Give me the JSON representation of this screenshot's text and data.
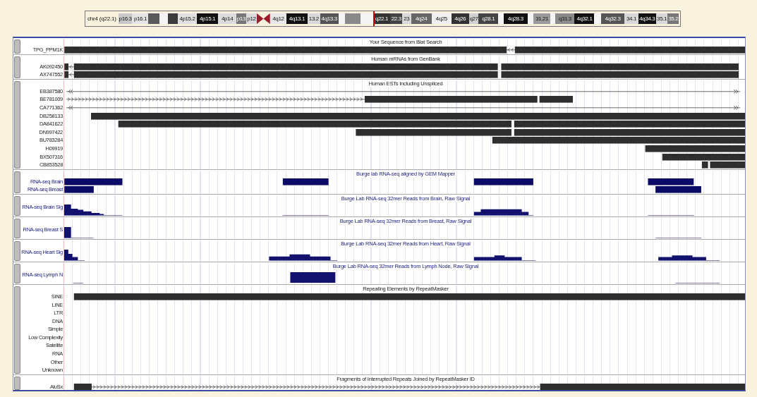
{
  "ideogram": {
    "label": "chr4 (q22.1)",
    "bands": [
      {
        "label": "p16.3",
        "color": "#c8c8c8",
        "kind": "band",
        "marked": false
      },
      {
        "label": "p16.1",
        "color": "#e4e4e4",
        "kind": "band",
        "marked": false
      },
      {
        "color": "#5a5a5a",
        "kind": "band",
        "marked": false
      },
      {
        "color": "#f4f4f4",
        "kind": "band",
        "marked": false
      },
      {
        "color": "#3c3c3c",
        "kind": "band",
        "marked": false
      },
      {
        "label": "4p15.2",
        "color": "#e0e0e0",
        "kind": "band",
        "marked": false
      },
      {
        "label": "4p15.1",
        "color": "#111111",
        "kind": "band",
        "marked": false
      },
      {
        "label": "4p14",
        "color": "#dcdcdc",
        "kind": "band",
        "marked": false
      },
      {
        "label": "p13",
        "color": "#777777",
        "kind": "band",
        "marked": false
      },
      {
        "label": "p12",
        "color": "#dcdcdc",
        "kind": "band",
        "marked": false
      },
      {
        "color": "#9b1c2c",
        "kind": "centromere",
        "marked": false
      },
      {
        "label": "4q12",
        "color": "#e8e8e8",
        "kind": "band",
        "marked": false
      },
      {
        "label": "4q13.1",
        "color": "#111111",
        "kind": "band",
        "marked": false
      },
      {
        "label": "13.2",
        "color": "#d8d8d8",
        "kind": "band",
        "marked": false
      },
      {
        "label": "4q13.3",
        "color": "#555555",
        "kind": "band",
        "marked": false
      },
      {
        "color": "#f4f4f4",
        "kind": "band",
        "marked": false
      },
      {
        "color": "#8a8a8a",
        "kind": "band",
        "marked": false
      },
      {
        "color": "#f4f4f4",
        "kind": "band",
        "marked": false
      },
      {
        "label": "q22.1",
        "color": "#333333",
        "kind": "band",
        "marked": true
      },
      {
        "label": "22.3",
        "color": "#444444",
        "kind": "band",
        "marked": false
      },
      {
        "label": "23",
        "color": "#d8d8d8",
        "kind": "band",
        "marked": false
      },
      {
        "label": "4q24",
        "color": "#666666",
        "kind": "band",
        "marked": false
      },
      {
        "label": "4q25",
        "color": "#f0f0f0",
        "kind": "band",
        "marked": false
      },
      {
        "label": "4q26",
        "color": "#333333",
        "kind": "band",
        "marked": false
      },
      {
        "label": "q27",
        "color": "#d0d0d0",
        "kind": "band",
        "marked": false
      },
      {
        "label": "q28.1",
        "color": "#444444",
        "kind": "band",
        "marked": false
      },
      {
        "color": "#f4f4f4",
        "kind": "band",
        "marked": false
      },
      {
        "label": "4q28.3",
        "color": "#111111",
        "kind": "band",
        "marked": false
      },
      {
        "color": "#f4f4f4",
        "kind": "band",
        "marked": false
      },
      {
        "label": "31.21",
        "color": "#9a9a9a",
        "kind": "band",
        "marked": false
      },
      {
        "color": "#f4f4f4",
        "kind": "band",
        "marked": false
      },
      {
        "label": "q31.3",
        "color": "#8a8a8a",
        "kind": "band",
        "marked": false
      },
      {
        "label": "4q32.1",
        "color": "#111111",
        "kind": "band",
        "marked": false
      },
      {
        "color": "#f4f4f4",
        "kind": "band",
        "marked": false
      },
      {
        "label": "4q32.3",
        "color": "#555555",
        "kind": "band",
        "marked": false
      },
      {
        "label": "34.1",
        "color": "#d8d8d8",
        "kind": "band",
        "marked": false
      },
      {
        "label": "4q34.3",
        "color": "#111111",
        "kind": "band",
        "marked": false
      },
      {
        "label": "35.1",
        "color": "#d8d8d8",
        "kind": "band",
        "marked": false
      },
      {
        "label": "35.2",
        "color": "#777777",
        "kind": "band",
        "marked": false
      }
    ]
  },
  "tracks": [
    {
      "title": "Your Sequence from Blat Search",
      "kind": "annotation",
      "rows": [
        {
          "label": "TPG_PPM1K"
        }
      ]
    },
    {
      "title": "Human mRNAs from GenBank",
      "kind": "annotation",
      "rows": [
        {
          "label": "AK092450"
        },
        {
          "label": "AX747552"
        }
      ]
    },
    {
      "title": "Human ESTs Including Unspliced",
      "kind": "annotation",
      "rows": [
        {
          "label": "EB387580"
        },
        {
          "label": "BE781009"
        },
        {
          "label": "CA771362"
        },
        {
          "label": "DB258133"
        },
        {
          "label": "DA841622"
        },
        {
          "label": "DN997422"
        },
        {
          "label": "BU783284"
        },
        {
          "label": "H09919"
        },
        {
          "label": "BX507316"
        },
        {
          "label": "CB853528"
        }
      ]
    },
    {
      "title": "Burge lab RNA-seq aligned by GEM Mapper",
      "kind": "rnaseq",
      "rows": [
        {
          "label": "RNA-seq Brain"
        },
        {
          "label": "RNA-seq Breast"
        }
      ]
    },
    {
      "title": "Burge Lab RNA-seq 32mer Reads from Brain, Raw Signal",
      "kind": "signal",
      "rows": [
        {
          "label": "RNA-seq Brain Sig"
        }
      ]
    },
    {
      "title": "Burge Lab RNA-seq 32mer Reads from Breast, Raw Signal",
      "kind": "signal",
      "rows": [
        {
          "label": "RNA-seq Breast S"
        }
      ]
    },
    {
      "title": "Burge Lab RNA-seq 32mer Reads from Heart, Raw Signal",
      "kind": "signal",
      "rows": [
        {
          "label": "RNA-seq Heart Sig"
        }
      ]
    },
    {
      "title": "Burge Lab RNA-seq 32mer Reads from Lymph Node, Raw Signal",
      "kind": "signal",
      "rows": [
        {
          "label": "RNA-seq Lymph N"
        }
      ]
    },
    {
      "title": "Repeating Elements by RepeatMasker",
      "kind": "repeat",
      "rows": [
        {
          "label": "SINE"
        },
        {
          "label": "LINE"
        },
        {
          "label": "LTR"
        },
        {
          "label": "DNA"
        },
        {
          "label": "Simple"
        },
        {
          "label": "Low Complexity"
        },
        {
          "label": "Satellite"
        },
        {
          "label": "RNA"
        },
        {
          "label": "Other"
        },
        {
          "label": "Unknown"
        }
      ]
    },
    {
      "title": "Fragments of Interrupted Repeats Joined by RepeatMasker ID",
      "kind": "repeat",
      "rows": [
        {
          "label": "AluSx"
        }
      ]
    }
  ]
}
